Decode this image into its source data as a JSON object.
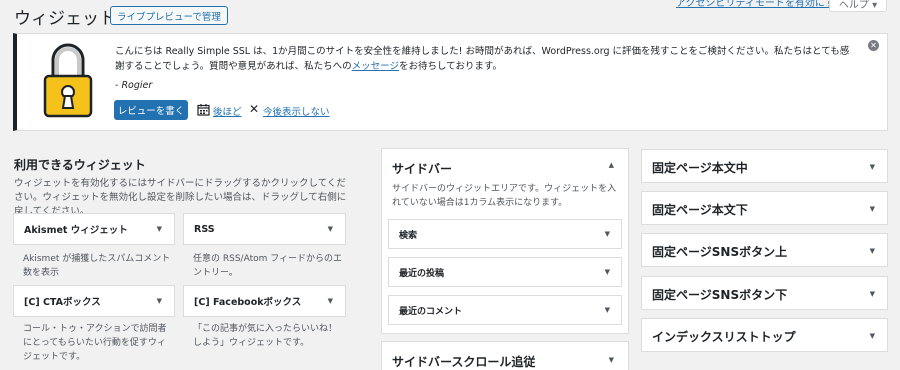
{
  "header": {
    "title": "ウィジェット",
    "live_preview_label": "ライブプレビューで管理",
    "top_link": "アクセシビリティモードを有効にする",
    "help_tab": "ヘルプ ▾"
  },
  "notice": {
    "message_before_link": "こんにちは Really Simple SSL は、1か月間このサイトを安全性を維持しました! お時間があれば、WordPress.org に評価を残すことをご検討ください。私たちはとても感謝することでしょう。質問や意見があれば、私たちへの",
    "message_link": "メッセージ",
    "message_after_link": "をお待ちしております。",
    "signature": "- Rogier",
    "review_button": "レビューを書く",
    "later_link": "後ほど",
    "dismiss_link": "今後表示しない",
    "lock_icon": "padlock-icon",
    "close_icon": "dismiss-circle-icon"
  },
  "available": {
    "title": "利用できるウィジェット",
    "description": "ウィジェットを有効化するにはサイドバーにドラッグするかクリックしてください。ウィジェットを無効化し設定を削除したい場合は、ドラッグして右側に戻してください。",
    "widgets": [
      {
        "name": "Akismet ウィジェット",
        "description": "Akismet が捕獲したスパムコメント数を表示"
      },
      {
        "name": "RSS",
        "description": "任意の RSS/Atom フィードからのエントリー。"
      },
      {
        "name": "[C] CTAボックス",
        "description": "コール・トゥ・アクションで訪問者にとってもらいたい行動を促すウィジェットです。"
      },
      {
        "name": "[C] Facebookボックス",
        "description": "「この記事が気に入ったらいいね！しよう」ウィジェットです。"
      }
    ]
  },
  "sidebar": {
    "title": "サイドバー",
    "description": "サイドバーのウィジットエリアです。ウィジェットを入れていない場合は1カラム表示になります。",
    "widgets": [
      "検索",
      "最近の投稿",
      "最近のコメント"
    ]
  },
  "sidebar_scroll": {
    "title": "サイドバースクロール追従"
  },
  "widget_areas": [
    "固定ページ本文中",
    "固定ページ本文下",
    "固定ページSNSボタン上",
    "固定ページSNSボタン下",
    "インデックスリストトップ"
  ],
  "colors": {
    "accent": "#2271b1",
    "background": "#f1f1f1",
    "lock_yellow": "#f5c21b"
  }
}
